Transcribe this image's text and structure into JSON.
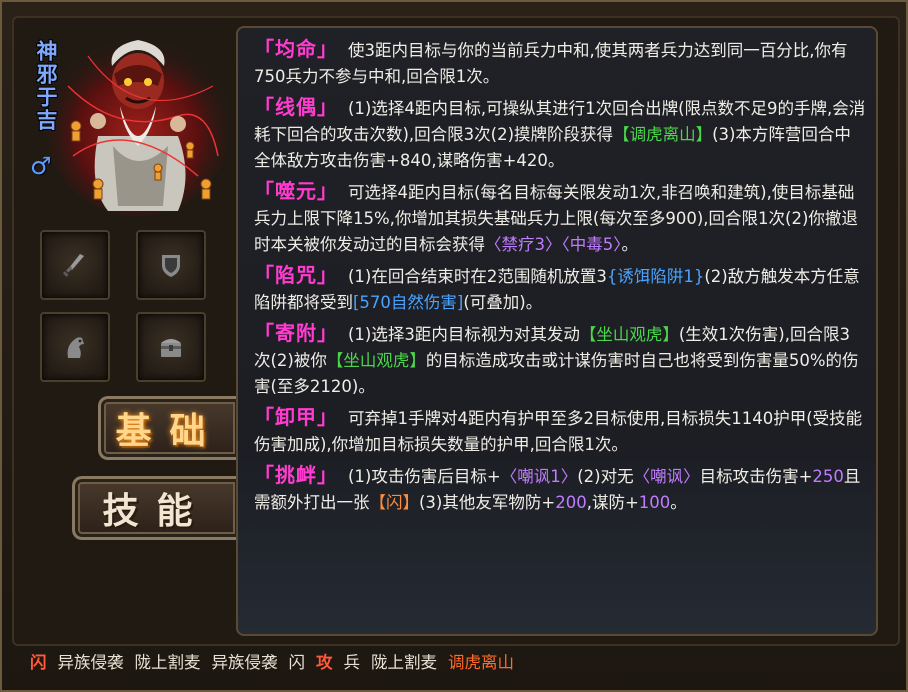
{
  "hero": {
    "name": "神邪于吉",
    "gender_symbol": "♂",
    "gender_icon": "male-symbol-icon",
    "name_color": "#7fa8ff"
  },
  "equipment_slots": [
    {
      "name": "weapon-slot",
      "icon": "sword-icon"
    },
    {
      "name": "armor-slot",
      "icon": "shield-icon"
    },
    {
      "name": "mount-slot",
      "icon": "horse-icon"
    },
    {
      "name": "treasure-slot",
      "icon": "chest-icon"
    }
  ],
  "tabs": {
    "basic": "基础",
    "skill": "技能"
  },
  "skills": [
    {
      "name": "「均命」",
      "parts": [
        {
          "t": "使3距内目标与你的当前兵力中和,使其两者兵力达到同一百分比,你有750兵力不参与中和,回合限1次。",
          "c": ""
        }
      ]
    },
    {
      "name": "「线偶」",
      "parts": [
        {
          "t": "(1)选择4距内目标,可操纵其进行1次回合出牌(限点数不足9的手牌,会消耗下回合的攻击次数),回合限3次(2)摸牌阶段获得",
          "c": ""
        },
        {
          "t": "【调虎离山】",
          "c": "g"
        },
        {
          "t": "(3)本方阵营回合中全体敌方攻击伤害+840,谋略伤害+420。",
          "c": ""
        }
      ]
    },
    {
      "name": "「噬元」",
      "parts": [
        {
          "t": "可选择4距内目标(每名目标每关限发动1次,非召唤和建筑),使目标基础兵力上限下降15%,你增加其损失基础兵力上限(每次至多900),回合限1次(2)你撤退时本关被你发动过的目标会获得",
          "c": ""
        },
        {
          "t": "〈禁疗3〉〈中毒5〉",
          "c": "p"
        },
        {
          "t": "。",
          "c": ""
        }
      ]
    },
    {
      "name": "「陷咒」",
      "parts": [
        {
          "t": "(1)在回合结束时在2范围随机放置3",
          "c": ""
        },
        {
          "t": "{诱饵陷阱1}",
          "c": "b"
        },
        {
          "t": "(2)敌方触发本方任意陷阱都将受到",
          "c": ""
        },
        {
          "t": "[570自然伤害]",
          "c": "b"
        },
        {
          "t": "(可叠加)。",
          "c": ""
        }
      ]
    },
    {
      "name": "「寄附」",
      "parts": [
        {
          "t": "(1)选择3距内目标视为对其发动",
          "c": ""
        },
        {
          "t": "【坐山观虎】",
          "c": "g"
        },
        {
          "t": "(生效1次伤害),回合限3次(2)被你",
          "c": ""
        },
        {
          "t": "【坐山观虎】",
          "c": "g"
        },
        {
          "t": "的目标造成攻击或计谋伤害时自己也将受到伤害量50%的伤害(至多2120)。",
          "c": ""
        }
      ]
    },
    {
      "name": "「卸甲」",
      "parts": [
        {
          "t": "可弃掉1手牌对4距内有护甲至多2目标使用,目标损失1140护甲(受技能伤害加成),你增加目标损失数量的护甲,回合限1次。",
          "c": ""
        }
      ]
    },
    {
      "name": "「挑衅」",
      "parts": [
        {
          "t": "(1)攻击伤害后目标+",
          "c": ""
        },
        {
          "t": "〈嘲讽1〉",
          "c": "p"
        },
        {
          "t": "(2)对无",
          "c": ""
        },
        {
          "t": "〈嘲讽〉",
          "c": "p"
        },
        {
          "t": "目标攻击伤害+",
          "c": ""
        },
        {
          "t": "250",
          "c": "p"
        },
        {
          "t": "且需额外打出一张",
          "c": ""
        },
        {
          "t": "【闪】",
          "c": "o"
        },
        {
          "t": "(3)其他友军物防+",
          "c": ""
        },
        {
          "t": "200",
          "c": "p"
        },
        {
          "t": ",谋防+",
          "c": ""
        },
        {
          "t": "100",
          "c": "p"
        },
        {
          "t": "。",
          "c": ""
        }
      ]
    }
  ],
  "card_bar": [
    {
      "t": "闪",
      "c": "hl"
    },
    {
      "t": "异族侵袭",
      "c": ""
    },
    {
      "t": "陇上割麦",
      "c": ""
    },
    {
      "t": "异族侵袭",
      "c": ""
    },
    {
      "t": "闪",
      "c": ""
    },
    {
      "t": "攻",
      "c": "hl"
    },
    {
      "t": "兵",
      "c": ""
    },
    {
      "t": "陇上割麦",
      "c": ""
    },
    {
      "t": "调虎离山",
      "c": "hl2"
    }
  ],
  "colors": {
    "skill_name": "#ff3bd0",
    "green_card": "#4bd64b",
    "blue_effect": "#4aa3ff",
    "purple_status": "#c07cff",
    "orange_card": "#ff8c3a"
  }
}
